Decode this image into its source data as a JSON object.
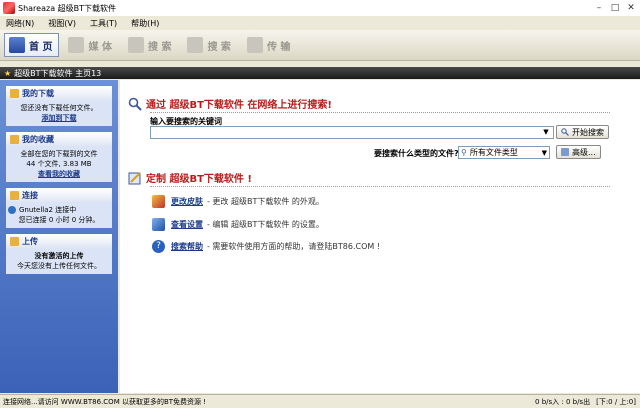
{
  "window": {
    "title": "Shareaza 超级BT下载软件"
  },
  "menu": [
    "网络(N)",
    "视图(V)",
    "工具(T)",
    "帮助(H)"
  ],
  "toolbar": [
    {
      "label": "首 页",
      "active": true
    },
    {
      "label": "媒 体",
      "active": false
    },
    {
      "label": "搜 索",
      "active": false
    },
    {
      "label": "搜 索",
      "active": false
    },
    {
      "label": "传 输",
      "active": false
    }
  ],
  "header_strip": "超级BT下载软件 主页13",
  "sidebar": {
    "downloads": {
      "title": "我的下载",
      "line1": "您还没有下载任何文件。",
      "link": "添加到下载"
    },
    "library": {
      "title": "我的收藏",
      "line1": "全部在您的下载到的文件",
      "line2": "44 个文件, 3.83 MB",
      "link": "查看我的收藏"
    },
    "connection": {
      "title": "连接",
      "line1": "Gnutella2 连接中",
      "line2": "您已连接 0 小时 0 分钟。"
    },
    "uploads": {
      "title": "上传",
      "line1": "没有激活的上传",
      "line2": "今天您没有上传任何文件。"
    }
  },
  "search": {
    "title": "通过 超级BT下载软件 在网络上进行搜索!",
    "input_label": "输入要搜索的关键词",
    "input_value": "",
    "button": "开始搜索",
    "type_label": "要搜索什么类型的文件?",
    "type_value": "所有文件类型",
    "advanced_button": "高级..."
  },
  "customize": {
    "title": "定制 超级BT下载软件 !",
    "tasks": [
      {
        "link": "更改皮肤",
        "desc": "- 更改 超级BT下载软件 的外观。"
      },
      {
        "link": "查看设置",
        "desc": "- 编辑 超级BT下载软件 的设置。"
      },
      {
        "link": "搜索帮助",
        "desc": "- 需要软件使用方面的帮助，请登陆BT86.COM !"
      }
    ]
  },
  "status": {
    "left": "连接网络...请访问 WWW.BT86.COM 以获取更多的BT免费资源 !",
    "speed": "0 b/s入 : 0 b/s出",
    "pages": "[下:0 / 上:0]"
  }
}
